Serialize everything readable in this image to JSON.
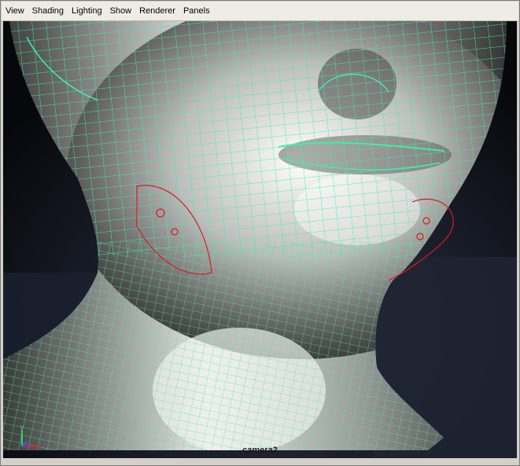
{
  "menubar": {
    "items": [
      "View",
      "Shading",
      "Lighting",
      "Show",
      "Renderer",
      "Panels"
    ]
  },
  "viewport": {
    "camera_label": "camera2",
    "background_color": "#0c0c10",
    "wireframe_color": "#3ef0a0",
    "annotation_color": "#e01818"
  },
  "axis": {
    "y_label": "y",
    "z_label": "z",
    "x_label": "x"
  }
}
